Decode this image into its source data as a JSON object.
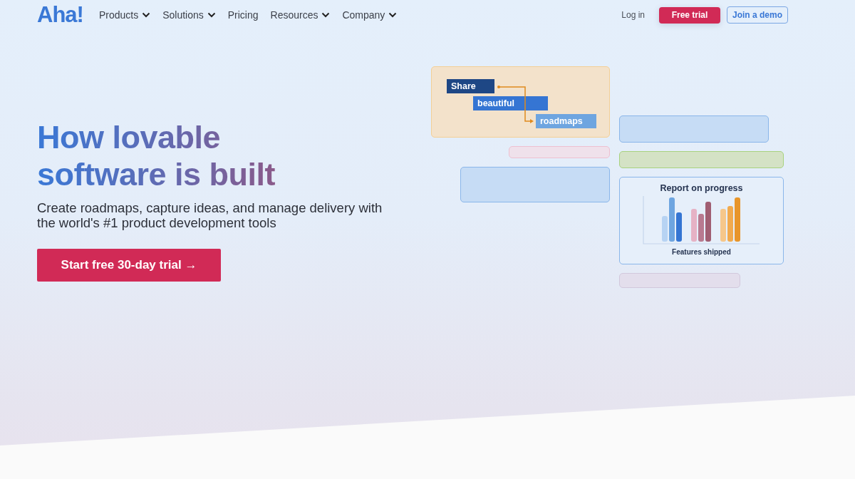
{
  "logo": "Aha!",
  "nav": [
    {
      "label": "Products",
      "has_menu": true
    },
    {
      "label": "Solutions",
      "has_menu": true
    },
    {
      "label": "Pricing",
      "has_menu": false
    },
    {
      "label": "Resources",
      "has_menu": true
    },
    {
      "label": "Company",
      "has_menu": true
    }
  ],
  "header_actions": [
    {
      "label": "Log in",
      "kind": "link"
    },
    {
      "label": "Free trial",
      "kind": "primary"
    },
    {
      "label": "Join a demo",
      "kind": "outline"
    }
  ],
  "hero": {
    "headline_lines": [
      "How lovable",
      "software is built"
    ],
    "subtitle": "Create roadmaps, capture ideas, and manage delivery with the world's #1 product development tools",
    "cta": "Start free 30-day trial →"
  },
  "illustration": {
    "tags": [
      {
        "label": "Share",
        "color": "#1e4785"
      },
      {
        "label": "beautiful",
        "color": "#3575d3"
      },
      {
        "label": "roadmaps",
        "color": "#6ea5e0"
      }
    ],
    "report": {
      "title": "Report on progress",
      "caption": "Features shipped"
    }
  }
}
